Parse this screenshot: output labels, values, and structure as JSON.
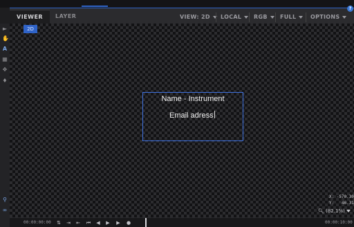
{
  "tabs": [
    {
      "label": "VIEWER",
      "active": true
    },
    {
      "label": "LAYER",
      "active": false
    }
  ],
  "toolbar": {
    "view_label": "VIEW: 2D",
    "space_label": "LOCAL",
    "channel_label": "RGB",
    "resolution_label": "FULL",
    "options_label": "OPTIONS",
    "help_glyph": "?"
  },
  "viewer": {
    "mode_badge": "2D"
  },
  "dialog": {
    "title": "Name - Instrument",
    "email_value": "Email adress"
  },
  "readout": {
    "x_label": "X:",
    "x_value": "-570.30",
    "y_label": "Y:",
    "y_value": "46.31",
    "zoom_label": "(82.1%)"
  },
  "timeline": {
    "start_time": "00:00:00:00",
    "end_time": "00:00:10:00"
  },
  "icons": {
    "left_tools": [
      "select-arrow-icon",
      "hand-icon",
      "text-tool-icon",
      "grid-icon",
      "move-icon",
      "stamp-icon"
    ],
    "bottom_left_tools": [
      "zoom-tool-icon",
      "link-icon"
    ],
    "playback": [
      "loop-icon",
      "to-in-icon",
      "to-out-icon",
      "first-frame-icon",
      "prev-frame-icon",
      "next-frame-icon",
      "play-icon",
      "record-icon"
    ],
    "zoom": "magnifier-icon"
  },
  "colors": {
    "accent": "#2f64c8",
    "dialog_border": "#3f72e0",
    "background": "#1e1e20"
  }
}
